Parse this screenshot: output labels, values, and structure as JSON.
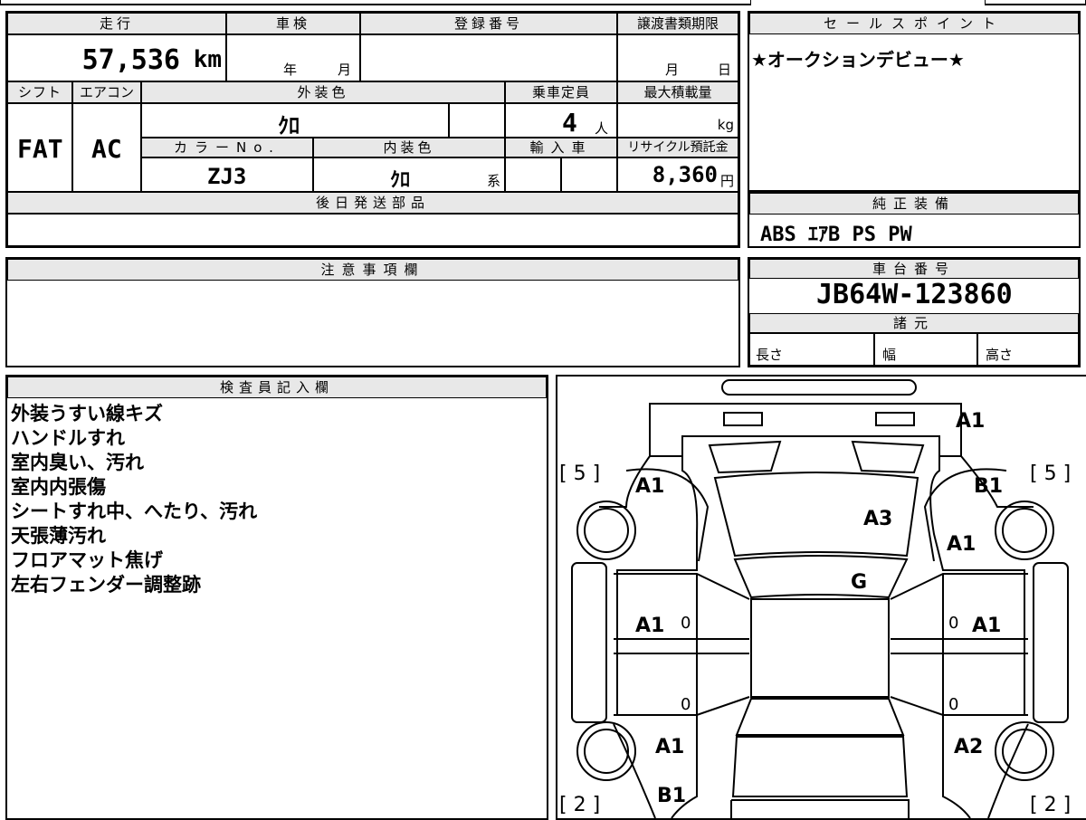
{
  "top_sheet": {
    "mileage_label": "走行",
    "mileage_value": "57,536",
    "mileage_unit": "km",
    "inspection_label": "車検",
    "inspection_year": "年",
    "inspection_month": "月",
    "registration_label": "登録番号",
    "transfer_deadline_label": "譲渡書類期限",
    "transfer_month": "月",
    "transfer_day": "日",
    "shift_label": "シフト",
    "shift_value": "FAT",
    "aircon_label": "エアコン",
    "aircon_value": "AC",
    "exterior_color_label": "外装色",
    "exterior_color_value": "ｸﾛ",
    "capacity_label": "乗車定員",
    "capacity_value": "4",
    "capacity_unit": "人",
    "max_load_label": "最大積載量",
    "max_load_unit": "kg",
    "color_no_label": "カラーNo.",
    "color_no_value": "ZJ3",
    "interior_color_label": "内装色",
    "interior_color_value": "ｸﾛ",
    "interior_color_suffix": "系",
    "import_label": "輸入車",
    "recycle_label": "リサイクル預託金",
    "recycle_value": "8,360",
    "recycle_unit": "円",
    "later_parts_label": "後日発送部品"
  },
  "sales_point": {
    "label": "セールスポイント",
    "text": "★オークションデビュー★"
  },
  "equipment": {
    "label": "純正装備",
    "value": "ABS ｴｱB PS PW"
  },
  "caution": {
    "label": "注意事項欄"
  },
  "chassis": {
    "label": "車台番号",
    "value": "JB64W-123860",
    "specs_label": "諸元",
    "length_label": "長さ",
    "width_label": "幅",
    "height_label": "高さ"
  },
  "inspector": {
    "label": "検査員記入欄",
    "notes": [
      "外装うすい線キズ",
      "ハンドルすれ",
      "室内臭い、汚れ",
      "室内内張傷",
      "シートすれ中、へたり、汚れ",
      "天張薄汚れ",
      "フロアマット焦げ",
      "左右フェンダー調整跡"
    ]
  },
  "diagram": {
    "marks": {
      "front_bumper": "A1",
      "front_left_fender": "A1",
      "front_right_fender": "B1",
      "hood": "A3",
      "right_front_fender_side": "A1",
      "windshield": "G",
      "left_front_door": "A1",
      "right_front_door": "A1",
      "left_rear_fender": "A1",
      "right_rear_fender": "A2",
      "rear_left": "B1",
      "left_front_door_zero": "0",
      "right_front_door_zero": "0",
      "left_rear_door_zero": "0",
      "right_rear_door_zero": "0"
    },
    "tire_labels": {
      "front_left": "[ 5 ]",
      "front_right": "[ 5 ]",
      "rear_left": "[ 2 ]",
      "rear_right": "[ 2 ]"
    }
  }
}
